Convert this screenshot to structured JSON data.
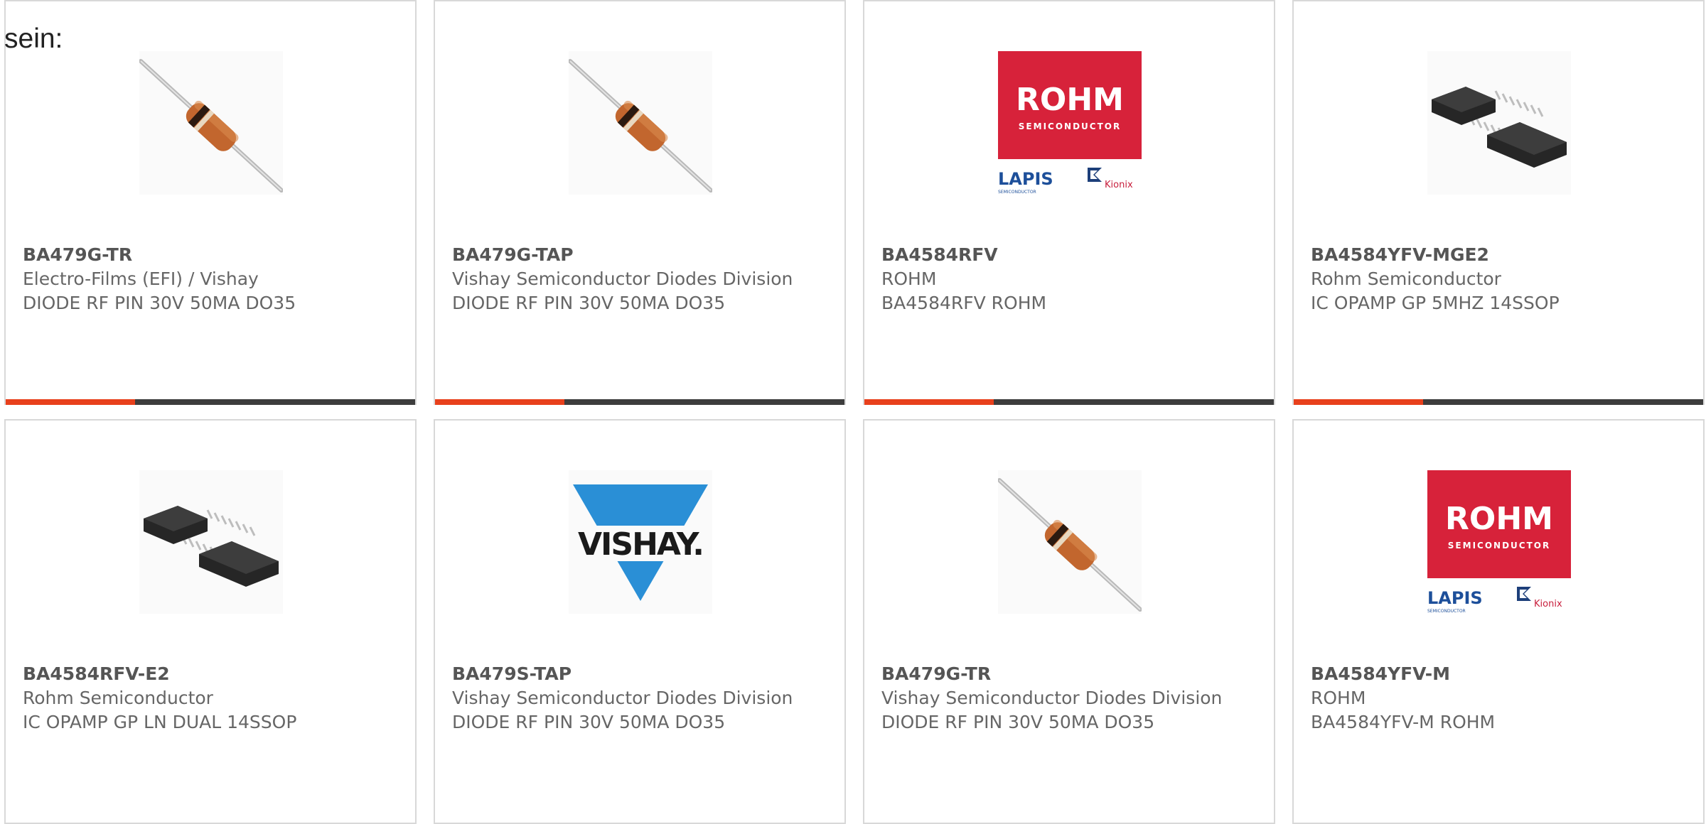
{
  "intro_text": "sein:",
  "products": [
    {
      "part_number": "BA479G-TR",
      "manufacturer": "Electro-Films (EFI) / Vishay",
      "description": "DIODE RF PIN 30V 50MA DO35",
      "image": "diode-icon"
    },
    {
      "part_number": "BA479G-TAP",
      "manufacturer": "Vishay Semiconductor Diodes Division",
      "description": "DIODE RF PIN 30V 50MA DO35",
      "image": "diode-icon"
    },
    {
      "part_number": "BA4584RFV",
      "manufacturer": "ROHM",
      "description": "BA4584RFV ROHM",
      "image": "rohm-logo",
      "logo": {
        "brand": "ROHM",
        "sub": "SEMICONDUCTOR",
        "lapis": "LAPIS",
        "lapis_sub": "SEMICONDUCTOR",
        "kionix": "Kionix"
      }
    },
    {
      "part_number": "BA4584YFV-MGE2",
      "manufacturer": "Rohm Semiconductor",
      "description": "IC OPAMP GP 5MHZ 14SSOP",
      "image": "ic-chip-icon"
    },
    {
      "part_number": "BA4584RFV-E2",
      "manufacturer": "Rohm Semiconductor",
      "description": "IC OPAMP GP LN DUAL 14SSOP",
      "image": "ic-chip-icon"
    },
    {
      "part_number": "BA479S-TAP",
      "manufacturer": "Vishay Semiconductor Diodes Division",
      "description": "DIODE RF PIN 30V 50MA DO35",
      "image": "vishay-logo",
      "logo": {
        "brand": "VISHAY."
      }
    },
    {
      "part_number": "BA479G-TR",
      "manufacturer": "Vishay Semiconductor Diodes Division",
      "description": "DIODE RF PIN 30V 50MA DO35",
      "image": "diode-icon"
    },
    {
      "part_number": "BA4584YFV-M",
      "manufacturer": "ROHM",
      "description": "BA4584YFV-M ROHM",
      "image": "rohm-logo",
      "logo": {
        "brand": "ROHM",
        "sub": "SEMICONDUCTOR",
        "lapis": "LAPIS",
        "lapis_sub": "SEMICONDUCTOR",
        "kionix": "Kionix"
      }
    }
  ],
  "colors": {
    "accent": "#e8401c",
    "bar_dark": "#3d3d3d",
    "rohm_red": "#d7223a",
    "vishay_blue": "#2a8fd6",
    "lapis_blue": "#1d4f9a"
  }
}
